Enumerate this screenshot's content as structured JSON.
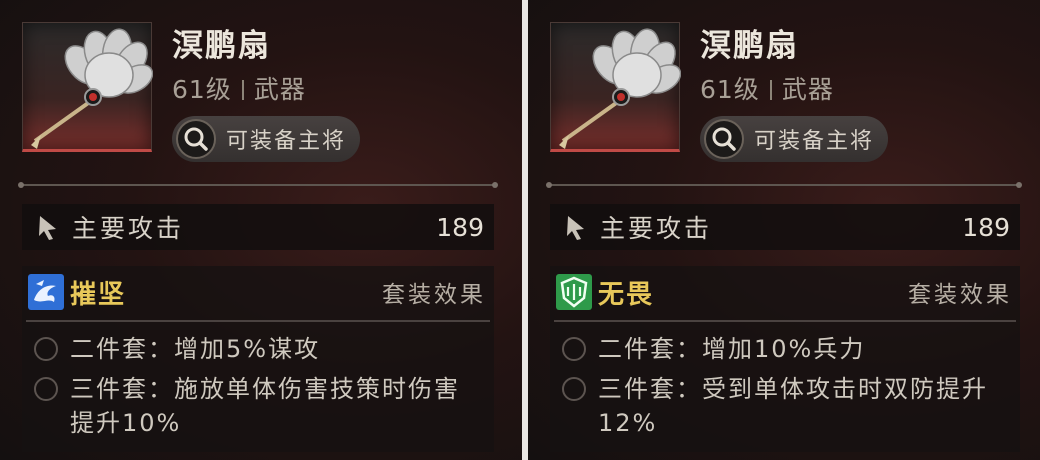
{
  "cards": [
    {
      "item_name": "溟鹏扇",
      "level": "61级",
      "item_type": "武器",
      "equip_button": "可装备主将",
      "stat_label": "主要攻击",
      "stat_value": "189",
      "set_name": "摧坚",
      "set_icon": "blue-swirl-icon",
      "set_effect_label": "套装效果",
      "bonus_2": "二件套：增加5%谋攻",
      "bonus_3": "三件套：施放单体伤害技策时伤害提升10%"
    },
    {
      "item_name": "溟鹏扇",
      "level": "61级",
      "item_type": "武器",
      "equip_button": "可装备主将",
      "stat_label": "主要攻击",
      "stat_value": "189",
      "set_name": "无畏",
      "set_icon": "green-shield-icon",
      "set_effect_label": "套装效果",
      "bonus_2": "二件套：增加10%兵力",
      "bonus_3": "三件套：受到单体攻击时双防提升12%"
    }
  ],
  "colors": {
    "set_name": "#e8c85a",
    "rarity_red": "#c04a46",
    "set_icon_blue": "#2f6fd6",
    "set_icon_green": "#2e9a4a"
  }
}
